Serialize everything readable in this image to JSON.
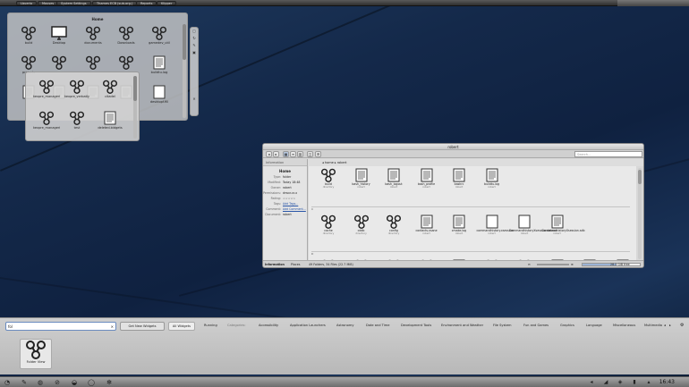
{
  "topbar": {
    "tabs": [
      "Lbuerio",
      "Mouses",
      "System Settings",
      "Thames ECB (sub-org.)",
      "Reports",
      "Klipper"
    ]
  },
  "home_folder": {
    "title": "Home",
    "items": [
      {
        "label": "build",
        "icon": "share-folder-icon"
      },
      {
        "label": "Desktop",
        "icon": "desktop-folder-icon"
      },
      {
        "label": "documents",
        "icon": "share-folder-icon"
      },
      {
        "label": "Downloads",
        "icon": "share-folder-icon"
      },
      {
        "label": "gamedev_util",
        "icon": "share-folder-icon"
      },
      {
        "label": "projects",
        "icon": "share-folder-icon"
      },
      {
        "label": "",
        "icon": "share-folder-icon"
      },
      {
        "label": "",
        "icon": "share-folder-icon"
      },
      {
        "label": "",
        "icon": "share-folder-icon"
      },
      {
        "label": "buildtu.log",
        "icon": "text-file-icon"
      },
      {
        "label": "",
        "icon": "text-file-icon"
      },
      {
        "label": "",
        "icon": "text-file-icon"
      },
      {
        "label": "",
        "icon": "text-file-icon"
      },
      {
        "label": "",
        "icon": "text-file-icon"
      },
      {
        "label": "desktopf.fill",
        "icon": "blank-file-icon"
      }
    ]
  },
  "sub_folder": {
    "items": [
      {
        "label": "kexpre_managerie",
        "icon": "share-folder-icon"
      },
      {
        "label": "kexpre_verbatly",
        "icon": "share-folder-icon"
      },
      {
        "label": "citadel",
        "icon": "share-folder-icon"
      },
      {
        "label": "kexpre_managerie",
        "icon": "share-folder-icon"
      },
      {
        "label": "test",
        "icon": "share-folder-icon"
      },
      {
        "label": "deleted.bidgets",
        "icon": "text-file-icon"
      },
      {
        "label": "deleted_bidgets",
        "icon": "radioactive-icon"
      }
    ]
  },
  "side_controls": [
    "▢",
    "↻",
    "✎",
    "▣",
    "✕"
  ],
  "dolphin": {
    "title": "robert",
    "search_placeholder": "Search...",
    "breadcrumb": "◂ home ▸ robert",
    "info_header": "Information",
    "info_title": "Home",
    "info_rows": [
      {
        "k": "Type:",
        "v": "folder"
      },
      {
        "k": "Modified:",
        "v": "Today 18:48"
      },
      {
        "k": "Owner:",
        "v": "robert"
      },
      {
        "k": "Permissions:",
        "v": "drwxr-xr-x"
      },
      {
        "k": "Rating:",
        "v": "☆☆☆☆☆"
      },
      {
        "k": "Tags:",
        "v": "Add Tags..."
      },
      {
        "k": "Comment:",
        "v": "Add Comment..."
      },
      {
        "k": "Document:",
        "v": "robert"
      }
    ],
    "groups": [
      {
        "label": "",
        "items": [
          {
            "label": "build",
            "sub": "directory",
            "icon": "share-folder-icon"
          },
          {
            "label": "bash_history",
            "sub": "robert",
            "icon": "text-file-icon"
          },
          {
            "label": "bash_logout",
            "sub": "robert",
            "icon": "text-file-icon"
          },
          {
            "label": "bash_profile",
            "sub": "robert",
            "icon": "text-file-icon"
          },
          {
            "label": "bashrc",
            "sub": "robert",
            "icon": "text-file-icon"
          },
          {
            "label": "buildtu.log",
            "sub": "robert",
            "icon": "text-file-icon"
          }
        ]
      },
      {
        "label": "C",
        "items": [
          {
            "label": "cache",
            "sub": "directory",
            "icon": "share-folder-icon"
          },
          {
            "label": "cddb",
            "sub": "directory",
            "icon": "share-folder-icon"
          },
          {
            "label": "config",
            "sub": "directory",
            "icon": "share-folder-icon"
          },
          {
            "label": "contacts.xsane",
            "sub": "robert",
            "icon": "text-file-icon"
          },
          {
            "label": "cmake.log",
            "sub": "robert",
            "icon": "text-file-icon"
          },
          {
            "label": "commandhistory.xsession",
            "sub": "robert",
            "icon": "blank-file-icon"
          },
          {
            "label": "CommandhistoryXsession.dataxx",
            "sub": "robert",
            "icon": "blank-file-icon"
          },
          {
            "label": "CommandhistoryXsession.sdb",
            "sub": "robert",
            "icon": "text-file-icon"
          }
        ]
      },
      {
        "label": "D",
        "items": [
          {
            "label": "",
            "sub": "",
            "icon": "share-folder-icon"
          },
          {
            "label": "",
            "sub": "",
            "icon": "share-folder-icon"
          },
          {
            "label": "",
            "sub": "",
            "icon": "share-folder-icon"
          },
          {
            "label": "",
            "sub": "",
            "icon": "share-folder-icon"
          },
          {
            "label": "",
            "sub": "",
            "icon": "text-file-icon"
          },
          {
            "label": "",
            "sub": "",
            "icon": "share-folder-icon"
          },
          {
            "label": "",
            "sub": "",
            "icon": "share-folder-icon"
          },
          {
            "label": "",
            "sub": "",
            "icon": "blank-file-icon"
          },
          {
            "label": "",
            "sub": "",
            "icon": "text-file-icon"
          },
          {
            "label": "",
            "sub": "",
            "icon": "blank-file-icon"
          }
        ]
      }
    ],
    "status_tabs": [
      "Information",
      "Places"
    ],
    "status_text": "49 Folders, 34 Files (22.7 MiB)",
    "free_space": "28.2 GiB free"
  },
  "widget_explorer": {
    "search_value": "fol",
    "get_new_label": "Get New Widgets",
    "categories": [
      "All Widgets",
      "Running",
      "Categories:",
      "Accessibility",
      "Application Launchers",
      "Astronomy",
      "Date and Time",
      "Development Tools",
      "Environment and Weather",
      "File System",
      "Fun and Games",
      "Graphics",
      "Language",
      "Miscellaneous",
      "Multimedia"
    ],
    "preview_label": "Folder View"
  },
  "taskbar": {
    "clock": "16:43",
    "icons": [
      "kickoff-icon",
      "brush-icon",
      "network-icon",
      "block-icon",
      "power-icon",
      "chat-icon",
      "settings-icon"
    ]
  }
}
